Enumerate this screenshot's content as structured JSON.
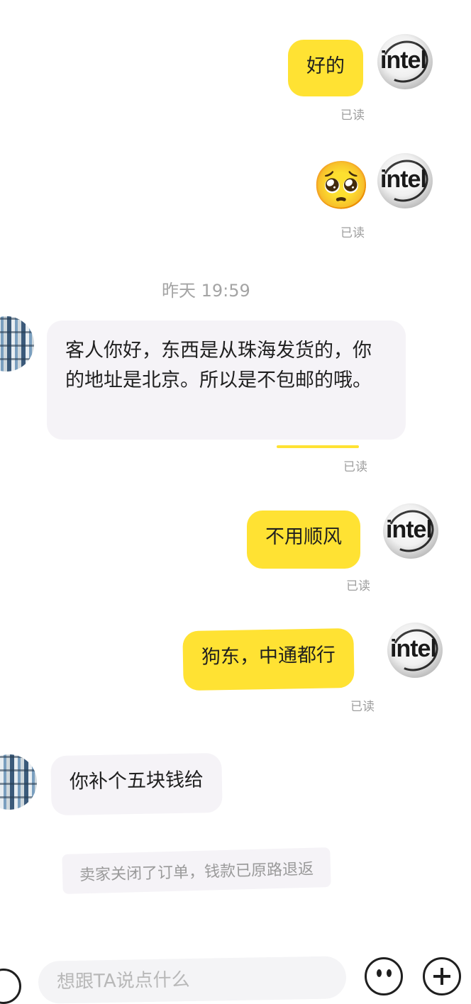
{
  "messages": [
    {
      "id": "m1",
      "text": "好的",
      "read": "已读"
    },
    {
      "id": "m2",
      "emoji": "🥺",
      "read": "已读"
    },
    {
      "id": "m3",
      "text": "客人你好，东西是从珠海发货的，你的地址是北京。所以是不包邮的哦。",
      "read": "已读"
    },
    {
      "id": "m4",
      "text": "不用顺风",
      "read": "已读"
    },
    {
      "id": "m5",
      "text": "狗东，中通都行",
      "read": "已读"
    },
    {
      "id": "m6",
      "text": "你补个五块钱给"
    }
  ],
  "timestamp": "昨天 19:59",
  "system_notice": "卖家关闭了订单，钱款已原路退返",
  "input": {
    "placeholder": "想跟TA说点什么"
  },
  "avatar_logo": "intel",
  "icons": {
    "emoji_button": "smiley-icon",
    "plus_button": "plus-icon",
    "voice_button": "voice-icon"
  },
  "colors": {
    "outgoing_bubble": "#ffe233",
    "incoming_bubble": "#f5f3f7",
    "read_text": "#9e9e9e"
  }
}
